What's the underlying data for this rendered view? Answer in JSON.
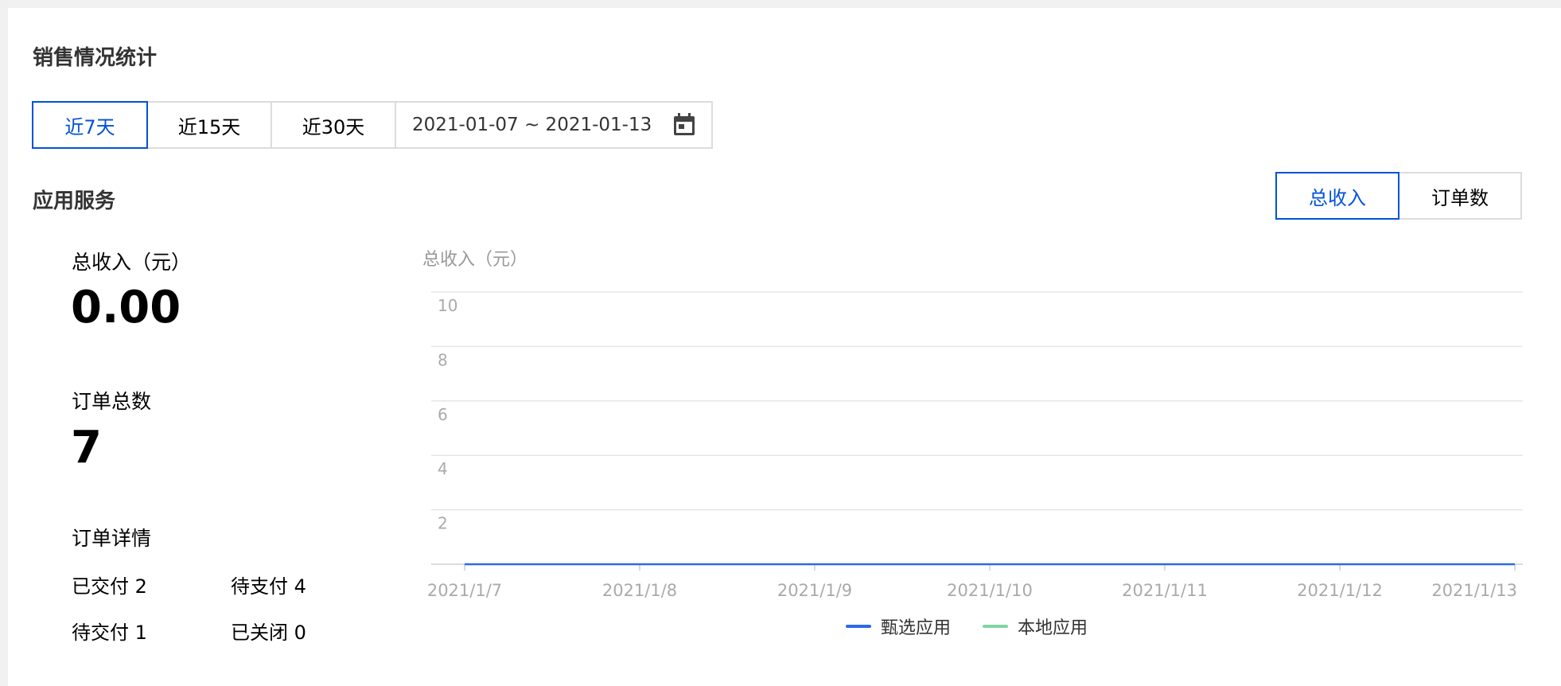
{
  "page": {
    "title": "销售情况统计"
  },
  "range": {
    "options": [
      "近7天",
      "近15天",
      "近30天"
    ],
    "selected": "近7天",
    "date_range": "2021-01-07 ~ 2021-01-13"
  },
  "section": {
    "title": "应用服务"
  },
  "metric_toggle": {
    "options": [
      "总收入",
      "订单数"
    ],
    "selected": "总收入"
  },
  "stats": {
    "revenue_label": "总收入（元）",
    "revenue_value": "0.00",
    "orders_label": "订单总数",
    "orders_value": "7",
    "details_label": "订单详情",
    "delivered": "已交付 2",
    "pending_payment": "待支付 4",
    "pending_delivery": "待交付 1",
    "closed": "已关闭 0"
  },
  "chart_data": {
    "type": "line",
    "ylabel": "总收入（元）",
    "x": [
      "2021/1/7",
      "2021/1/8",
      "2021/1/9",
      "2021/1/10",
      "2021/1/11",
      "2021/1/12",
      "2021/1/13"
    ],
    "ylim": [
      0,
      10
    ],
    "yticks": [
      "2",
      "4",
      "6",
      "8",
      "10"
    ],
    "grid": true,
    "legend": "bottom",
    "series": [
      {
        "name": "甄选应用",
        "color": "#2a6be6",
        "values": [
          0,
          0,
          0,
          0,
          0,
          0,
          0
        ]
      },
      {
        "name": "本地应用",
        "color": "#7fd6a0",
        "values": []
      }
    ]
  },
  "icons": {
    "calendar": "calendar-icon"
  },
  "colors": {
    "accent": "#0052d9",
    "border": "#dcdcdc"
  }
}
